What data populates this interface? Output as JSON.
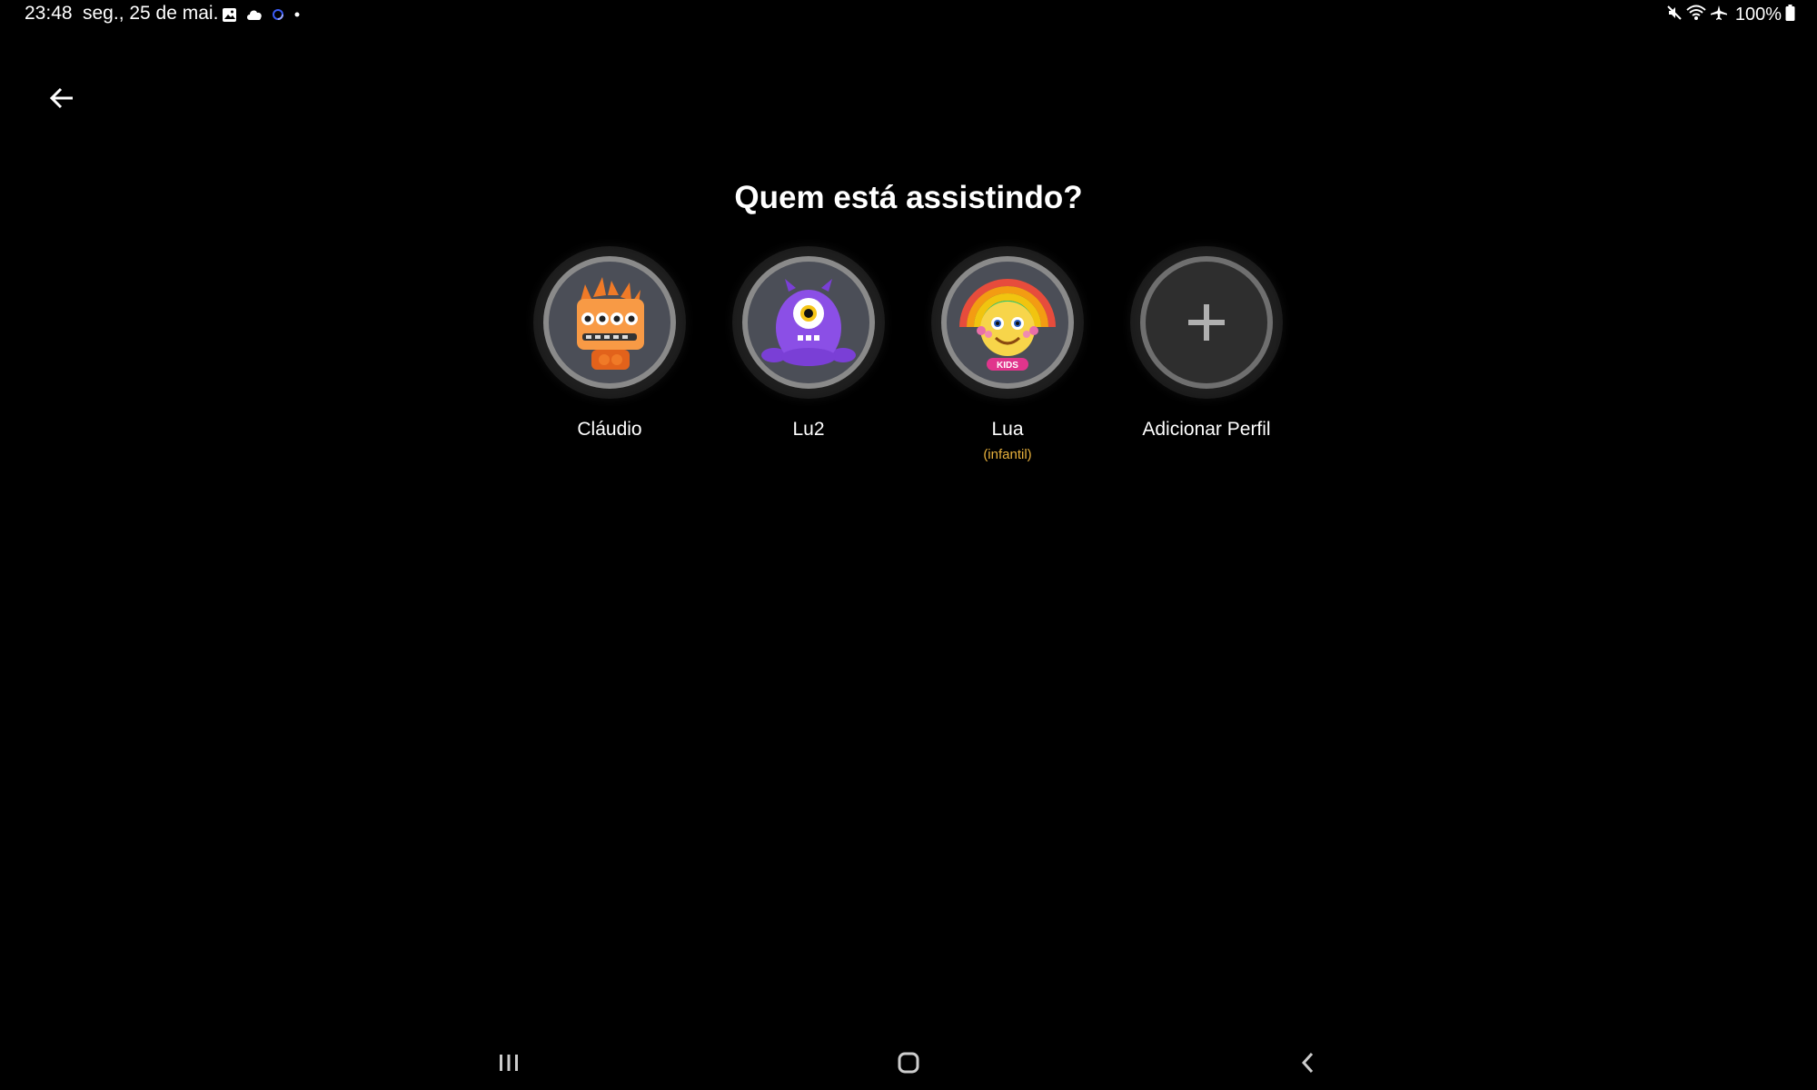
{
  "status_bar": {
    "time": "23:48",
    "date": "seg., 25 de mai.",
    "notification_icons": [
      "gallery-icon",
      "cloud-icon",
      "sync-icon",
      "more-dot-icon"
    ],
    "system_icons": [
      "mute-icon",
      "wifi-icon",
      "airplane-icon"
    ],
    "battery": "100%"
  },
  "header": {
    "back_icon": "arrow-left-icon"
  },
  "main": {
    "title": "Quem está assistindo?",
    "profiles": [
      {
        "name": "Cláudio",
        "avatar": "orange-robot-avatar"
      },
      {
        "name": "Lu2",
        "avatar": "purple-monster-avatar"
      },
      {
        "name": "Lua",
        "subtitle": "(infantil)",
        "avatar": "kids-rainbow-avatar",
        "badge": "KIDS"
      },
      {
        "name": "Adicionar Perfil",
        "avatar": "plus-icon"
      }
    ]
  },
  "nav_bar": {
    "recents_icon": "recents-icon",
    "home_icon": "home-icon",
    "back_icon": "back-chevron-icon"
  },
  "colors": {
    "background": "#000000",
    "subtitle": "#e8b13c",
    "avatar_bg": "#4b4e57"
  }
}
